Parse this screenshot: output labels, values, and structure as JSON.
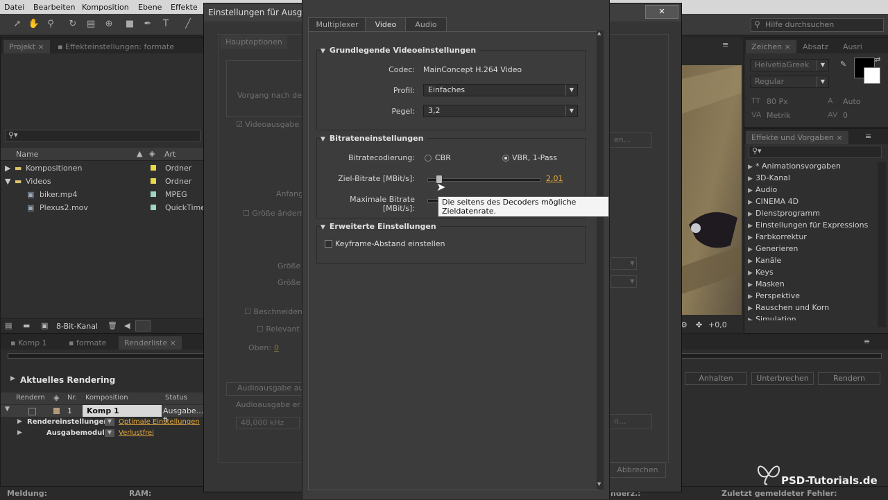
{
  "menu": [
    "Datei",
    "Bearbeiten",
    "Komposition",
    "Ebene",
    "Effekte"
  ],
  "help_search": {
    "placeholder": "Hilfe durchsuchen"
  },
  "project": {
    "tabs": [
      "Projekt",
      "Effekteinstellungen: formate"
    ],
    "columns": {
      "name": "Name",
      "type": "Art"
    },
    "items": [
      {
        "name": "Kompositionen",
        "type": "Ordner",
        "color": "#e8d84a"
      },
      {
        "name": "Videos",
        "type": "Ordner",
        "color": "#e8d84a"
      },
      {
        "name": "biker.mp4",
        "type": "MPEG",
        "color": "#9fd4c7"
      },
      {
        "name": "Plexus2.mov",
        "type": "QuickTime",
        "color": "#9fd4c7"
      }
    ],
    "bit_depth": "8-Bit-Kanal"
  },
  "render_queue": {
    "tabs": [
      "Komp 1",
      "formate",
      "Renderliste"
    ],
    "current_rendering": "Aktuelles Rendering",
    "columns": {
      "render": "Rendern",
      "number": "Nr.",
      "comp": "Komposition",
      "status": "Status"
    },
    "row": {
      "number": "1",
      "comp": "Komp 1",
      "status": "Ausgabe...i fi"
    },
    "render_settings_label": "Rendereinstellungen:",
    "render_settings_value": "Optimale Einstellungen",
    "output_module_label": "Ausgabemodul:",
    "output_module_value": "Verlustfrei",
    "buttons": {
      "stop": "Anhalten",
      "pause": "Unterbrechen",
      "render": "Rendern"
    },
    "status_message": "Meldung:",
    "status_ram": "RAM:",
    "status_errors_partial": "nderz.:",
    "status_last_error": "Zuletzt gemeldeter Fehler:"
  },
  "bg_dialog": {
    "title": "Einstellungen für Ausgab",
    "tab": "Hauptoptionen",
    "labels": {
      "after_render": "Vorgang nach der",
      "video_output": "Videoausgabe",
      "start": "Anfang",
      "resize": "Größe ändern",
      "size1": "Größe",
      "size2": "Größe",
      "crop": "Beschneiden",
      "relevant": "Relevant",
      "top": "Oben:",
      "top_value": "0",
      "audio_output": "Audioausgabe au",
      "audio_output2": "Audioausgabe er",
      "samplerate": "48,000 kHz",
      "cancel": "Abbrechen",
      "dots1": "n...",
      "dots2": "en..."
    }
  },
  "fg_dialog": {
    "tabs": [
      "Multiplexer",
      "Video",
      "Audio"
    ],
    "active_tab": "Video",
    "basic": {
      "title": "Grundlegende Videoeinstellungen",
      "codec_label": "Codec:",
      "codec_value": "MainConcept H.264 Video",
      "profile_label": "Profil:",
      "profile_value": "Einfaches",
      "level_label": "Pegel:",
      "level_value": "3,2"
    },
    "bitrate": {
      "title": "Bitrateneinstellungen",
      "encoding_label": "Bitratecodierung:",
      "cbr": "CBR",
      "vbr": "VBR, 1-Pass",
      "selected": "VBR, 1-Pass",
      "target_label": "Ziel-Bitrate [MBit/s]:",
      "target_value": "2,01",
      "target_fraction": 0.1,
      "max_label": "Maximale Bitrate [MBit/s]:",
      "tooltip": "Die seitens des Decoders mögliche Zieldatenrate."
    },
    "advanced": {
      "title": "Erweiterte Einstellungen",
      "keyframe_label": "Keyframe-Abstand einstellen",
      "keyframe_checked": false
    }
  },
  "character_panel": {
    "tabs": [
      "Zeichen",
      "Absatz",
      "Ausri"
    ],
    "font": "HelvetiaGreek",
    "style": "Regular",
    "size": "80 Px",
    "leading": "Auto",
    "kerning": "Metrik",
    "tracking": "0"
  },
  "effects_panel": {
    "title": "Effekte und Vorgaben",
    "items": [
      "* Animationsvorgaben",
      "3D-Kanal",
      "Audio",
      "CINEMA 4D",
      "Dienstprogramm",
      "Einstellungen für Expressions",
      "Farbkorrektur",
      "Generieren",
      "Kanäle",
      "Keys",
      "Masken",
      "Perspektive",
      "Rauschen und Korn",
      "Simulation"
    ]
  },
  "viewer": {
    "offset": "+0,0"
  },
  "watermark": "PSD-Tutorials.de"
}
